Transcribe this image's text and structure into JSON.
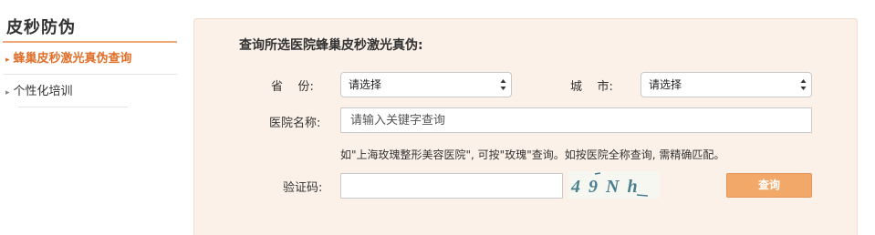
{
  "sidebar": {
    "title": "皮秒防伪",
    "items": [
      {
        "label": "蜂巢皮秒激光真伪查询",
        "active": true
      },
      {
        "label": "个性化培训",
        "active": false
      }
    ]
  },
  "form": {
    "heading": "查询所选医院蜂巢皮秒激光真伪:",
    "province_label": "省    份:",
    "province_value": "请选择",
    "city_label": "城    市:",
    "city_value": "请选择",
    "hospital_label": "医院名称:",
    "hospital_placeholder": "请输入关键字查询",
    "hint": "如\"上海玫瑰整形美容医院\", 可按\"玫瑰\"查询。如按医院全称查询, 需精确匹配。",
    "captcha_label": "验证码:",
    "captcha_value": "",
    "captcha_text": "49Nh",
    "submit_label": "查询"
  },
  "colors": {
    "accent": "#e0702a",
    "panel_bg": "#fcf1e8",
    "button_bg": "#f2a868",
    "captcha_ink": "#4a7f8f"
  }
}
